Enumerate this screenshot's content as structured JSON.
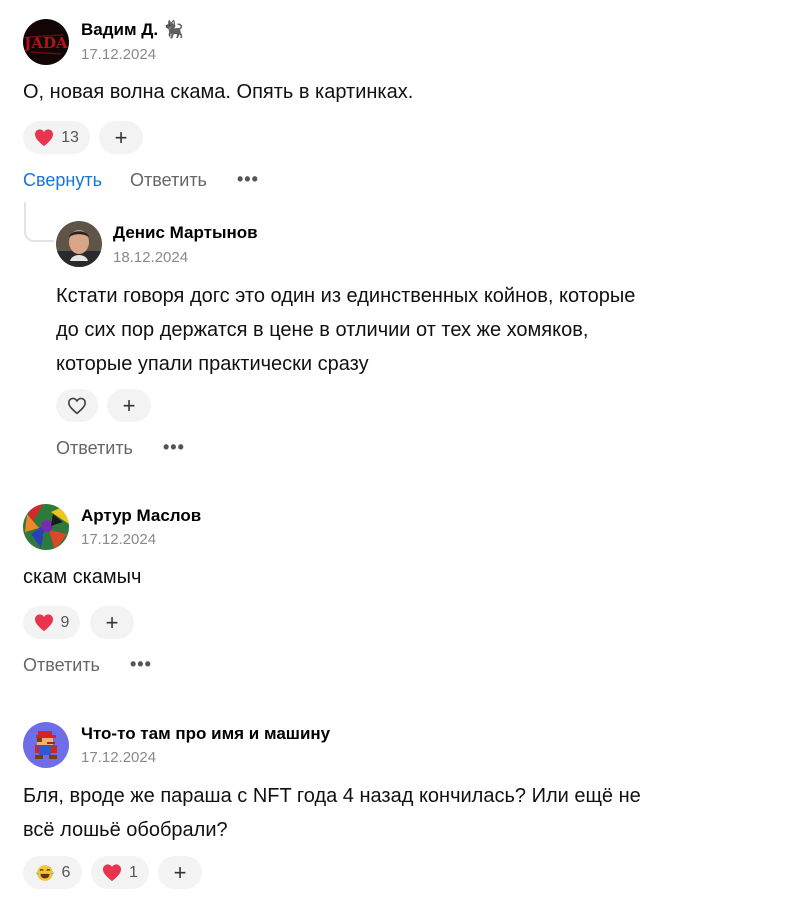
{
  "comments": [
    {
      "author": "Вадим Д. 🐈‍⬛",
      "date": "17.12.2024",
      "avatar_icon": "red-text-logo-avatar",
      "text_lines": [
        "О, новая волна скама. Опять в картинках."
      ],
      "reactions": [
        {
          "icon": "heart-icon",
          "count": "13"
        }
      ],
      "add_reaction": "+",
      "actions": {
        "collapse": "Свернуть",
        "reply": "Ответить",
        "more": "•••"
      }
    },
    {
      "author": "Денис Мартынов",
      "date": "18.12.2024",
      "avatar_icon": "man-portrait-avatar",
      "text_lines": [
        "Кстати говоря догс это один из единственных койнов, которые",
        "до сих пор держатся в цене в отличии от тех же хомяков,",
        "которые упали практически сразу"
      ],
      "reactions": [
        {
          "icon": "heart-outline-icon",
          "count": ""
        }
      ],
      "add_reaction": "+",
      "actions": {
        "reply": "Ответить",
        "more": "•••"
      }
    },
    {
      "author": "Артур Маслов",
      "date": "17.12.2024",
      "avatar_icon": "colorful-abstract-avatar",
      "text_lines": [
        "скам скамыч"
      ],
      "reactions": [
        {
          "icon": "heart-icon",
          "count": "9"
        }
      ],
      "add_reaction": "+",
      "actions": {
        "reply": "Ответить",
        "more": "•••"
      }
    },
    {
      "author": "Что-то там про имя и машину",
      "date": "17.12.2024",
      "avatar_icon": "pixel-mario-avatar",
      "text_lines": [
        "Бля, вроде же параша с NFT года 4 назад кончилась? Или ещё не",
        "всё лошьё обобрали?"
      ],
      "reactions": [
        {
          "icon": "laughing-tears-icon",
          "count": "6"
        },
        {
          "icon": "heart-icon",
          "count": "1"
        }
      ],
      "add_reaction": "+"
    }
  ],
  "colors": {
    "heart": "#e8344e",
    "link": "#1a73d9",
    "pill": "#f3f3f3",
    "date": "#8a8a8a"
  }
}
